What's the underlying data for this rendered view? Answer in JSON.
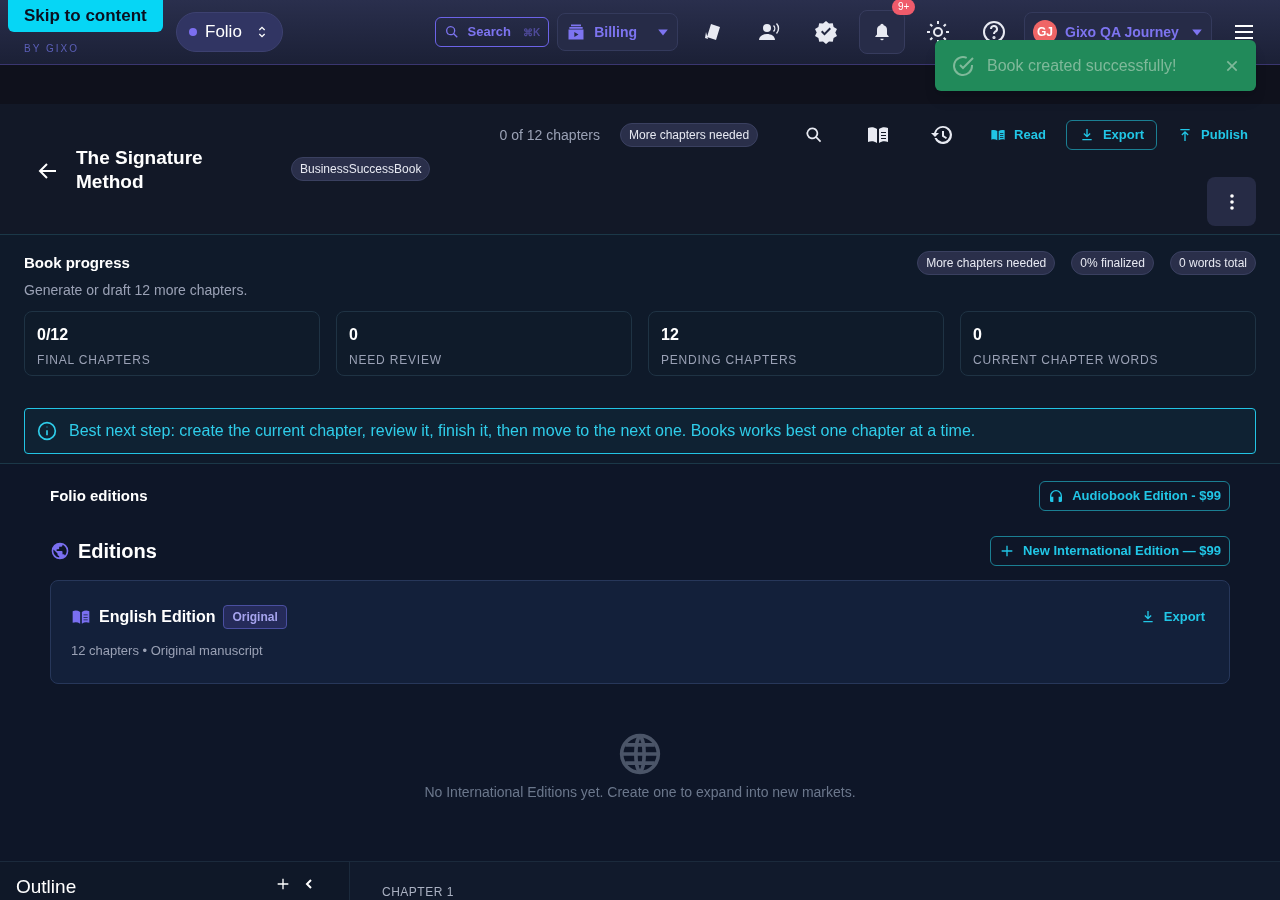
{
  "skip_link": "Skip to content",
  "brand": {
    "byline": "BY GIXO"
  },
  "workspace": {
    "label": "Folio"
  },
  "search": {
    "label": "Search",
    "shortcut": "⌘K"
  },
  "billing": {
    "label": "Billing"
  },
  "notifications": {
    "badge": "9+"
  },
  "account": {
    "initials": "GJ",
    "name": "Gixo QA Journey"
  },
  "toast": {
    "message": "Book created successfully!"
  },
  "book": {
    "title": "The Signature Method",
    "tag": "BusinessSuccessBook",
    "chapter_count": "0 of 12 chapters",
    "status": "More chapters needed",
    "actions": [
      {
        "kind": "read",
        "label": "Read"
      },
      {
        "kind": "export",
        "label": "Export"
      },
      {
        "kind": "publish",
        "label": "Publish"
      }
    ]
  },
  "progress": {
    "title": "Book progress",
    "subtitle": "Generate or draft 12 more chapters.",
    "badges": [
      "More chapters needed",
      "0% finalized",
      "0 words total"
    ],
    "stats": [
      {
        "value": "0/12",
        "label": "FINAL CHAPTERS"
      },
      {
        "value": "0",
        "label": "NEED REVIEW"
      },
      {
        "value": "12",
        "label": "PENDING CHAPTERS"
      },
      {
        "value": "0",
        "label": "CURRENT CHAPTER WORDS"
      }
    ],
    "tip": "Best next step: create the current chapter, review it, finish it, then move to the next one. Books works best one chapter at a time."
  },
  "editions": {
    "section_title": "Folio editions",
    "audiobook_button": "Audiobook Edition - $99",
    "title": "Editions",
    "new_button": "New International Edition — $99",
    "items": [
      {
        "name": "English Edition",
        "badge": "Original",
        "meta": "12 chapters • Original manuscript",
        "action": "Export"
      }
    ],
    "empty": "No International Editions yet. Create one to expand into new markets."
  },
  "outline": {
    "title": "Outline"
  },
  "chapter": {
    "label": "CHAPTER 1"
  }
}
